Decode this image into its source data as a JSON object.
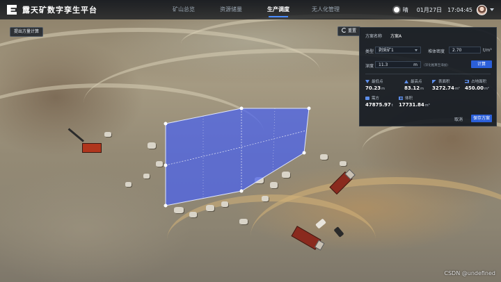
{
  "app": {
    "title": "露天矿数字孪生平台"
  },
  "nav": [
    {
      "label": "矿山总览",
      "active": false
    },
    {
      "label": "资源储量",
      "active": false
    },
    {
      "label": "生产调度",
      "active": true
    },
    {
      "label": "无人化管理",
      "active": false
    }
  ],
  "status": {
    "weather": "晴",
    "date": "01月27日",
    "time": "17:04:45"
  },
  "scene": {
    "calc_button": "提出方量计算",
    "reset_button": "重置",
    "watermark": "CSDN @undefined"
  },
  "panel": {
    "plan_name_label": "方案名称",
    "plan_name_value": "方案A",
    "type_label": "类型",
    "type_value": "剥采矿1",
    "density_label": "堆体密度",
    "density_value": "2.70",
    "density_unit": "t/m³",
    "depth_label": "深度",
    "depth_value": "11.3",
    "depth_unit": "m",
    "depth_hint": "(深化推算至海拔)",
    "compute_button": "计算",
    "metrics": [
      {
        "icon": "lowest-icon",
        "label": "最低点",
        "value": "70.23",
        "unit": "m"
      },
      {
        "icon": "highest-icon",
        "label": "最高点",
        "value": "83.12",
        "unit": "m"
      },
      {
        "icon": "area-icon",
        "label": "表面积",
        "value": "3272.74",
        "unit": "m²"
      },
      {
        "icon": "footprint-icon",
        "label": "占地面积",
        "value": "450.00",
        "unit": "m²"
      },
      {
        "icon": "fill-icon",
        "label": "需方",
        "value": "47875.97",
        "unit": "t"
      },
      {
        "icon": "cut-icon",
        "label": "体积",
        "value": "17731.84",
        "unit": "m³"
      }
    ],
    "cancel_button": "取消",
    "save_button": "保存方案"
  },
  "colors": {
    "accent": "#2b5fd9",
    "polygon_fill": "#4a63f0",
    "panel_bg": "#161b22"
  }
}
